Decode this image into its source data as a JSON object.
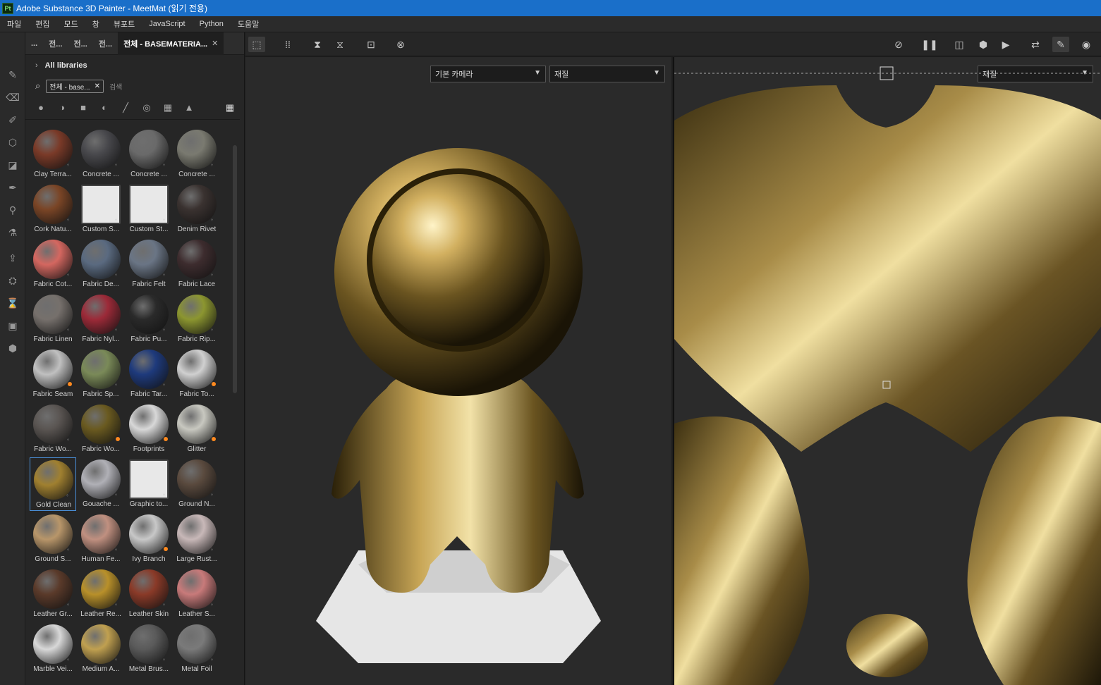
{
  "window": {
    "title": "Adobe Substance 3D Painter - MeetMat (읽기 전용)",
    "app_icon": "Pt"
  },
  "menu": [
    "파일",
    "편집",
    "모드",
    "창",
    "뷰포트",
    "JavaScript",
    "Python",
    "도움말"
  ],
  "tabs": [
    {
      "label": "..."
    },
    {
      "label": "전..."
    },
    {
      "label": "전..."
    },
    {
      "label": "전..."
    },
    {
      "label": "전체 - BASEMATERIA..."
    }
  ],
  "library": {
    "header": "All libraries",
    "filter_chip": "전체 - base...",
    "search_placeholder": "검색"
  },
  "assets": [
    {
      "label": "Clay Terra...",
      "color": "#7a3a28"
    },
    {
      "label": "Concrete ...",
      "color": "#48484c"
    },
    {
      "label": "Concrete ...",
      "color": "#6a6a6a"
    },
    {
      "label": "Concrete ...",
      "color": "#7a7a70"
    },
    {
      "label": "Cork Natu...",
      "color": "#7a4526"
    },
    {
      "label": "Custom S...",
      "color": "#e8e8e8",
      "icon": true
    },
    {
      "label": "Custom St...",
      "color": "#e8e8e8",
      "icon": true
    },
    {
      "label": "Denim Rivet",
      "color": "#3a3230"
    },
    {
      "label": "Fabric Cot...",
      "color": "#d46760"
    },
    {
      "label": "Fabric De...",
      "color": "#5a6a80"
    },
    {
      "label": "Fabric Felt",
      "color": "#6a7585"
    },
    {
      "label": "Fabric Lace",
      "color": "#3d2c2e"
    },
    {
      "label": "Fabric Linen",
      "color": "#76706c"
    },
    {
      "label": "Fabric Nyl...",
      "color": "#9c2a38"
    },
    {
      "label": "Fabric Pu...",
      "color": "#2a2a2a"
    },
    {
      "label": "Fabric Rip...",
      "color": "#8c9630"
    },
    {
      "label": "Fabric Seam",
      "color": "#c0c0c0"
    },
    {
      "label": "Fabric Sp...",
      "color": "#7a8a58"
    },
    {
      "label": "Fabric Tar...",
      "color": "#1e3a7c"
    },
    {
      "label": "Fabric To...",
      "color": "#d0d0d0"
    },
    {
      "label": "Fabric Wo...",
      "color": "#5a5552"
    },
    {
      "label": "Fabric Wo...",
      "color": "#6a5a20"
    },
    {
      "label": "Footprints",
      "color": "#d8d8d8"
    },
    {
      "label": "Glitter",
      "color": "#c8c8c0"
    },
    {
      "label": "Gold Clean",
      "color": "#a08030"
    },
    {
      "label": "Gouache ...",
      "color": "#b0b0b6"
    },
    {
      "label": "Graphic to...",
      "color": "#e8e8e8",
      "icon": true
    },
    {
      "label": "Ground N...",
      "color": "#5a4a3e"
    },
    {
      "label": "Ground S...",
      "color": "#b8966a"
    },
    {
      "label": "Human Fe...",
      "color": "#c09080"
    },
    {
      "label": "Ivy Branch",
      "color": "#c8c8c8"
    },
    {
      "label": "Large Rust...",
      "color": "#c8b8b8"
    },
    {
      "label": "Leather Gr...",
      "color": "#5a3a2a"
    },
    {
      "label": "Leather Re...",
      "color": "#b8902a"
    },
    {
      "label": "Leather Skin",
      "color": "#8a3a28"
    },
    {
      "label": "Leather S...",
      "color": "#c87a7a"
    },
    {
      "label": "Marble Vei...",
      "color": "#d8d8d8"
    },
    {
      "label": "Medium A...",
      "color": "#c0a050"
    },
    {
      "label": "Metal Brus...",
      "color": "#5a5a5a"
    },
    {
      "label": "Metal Foil",
      "color": "#7a7a7a"
    }
  ],
  "viewport3d": {
    "camera": "기본 카메라",
    "channel": "재질"
  },
  "viewport2d": {
    "channel": "재질"
  },
  "colors": {
    "title_bar": "#1a6fc9",
    "accent": "#4a8fd8",
    "gold": "#a08030"
  }
}
